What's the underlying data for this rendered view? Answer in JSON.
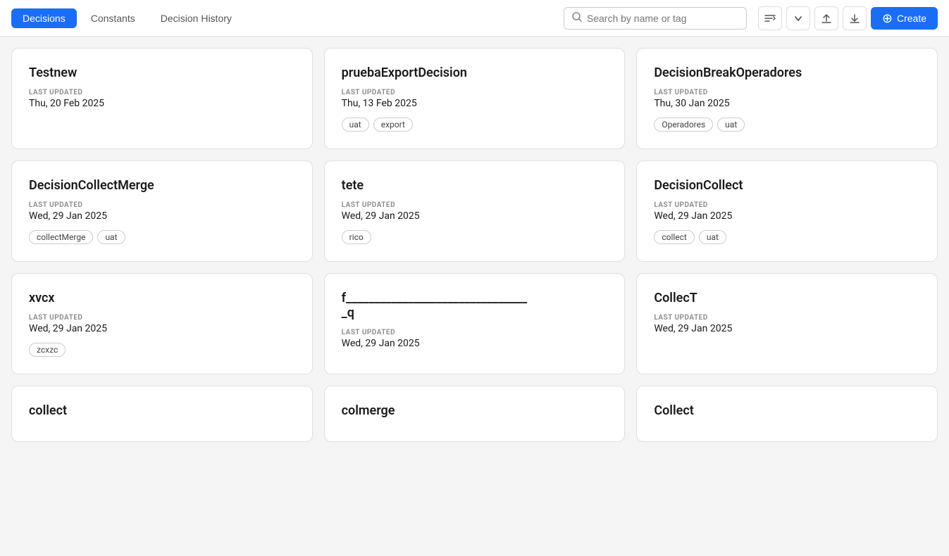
{
  "header": {
    "tabs": [
      {
        "label": "Decisions",
        "active": true
      },
      {
        "label": "Constants",
        "active": false
      },
      {
        "label": "Decision History",
        "active": false
      }
    ],
    "search": {
      "placeholder": "Search by name or tag"
    },
    "create_label": "Create"
  },
  "cards": [
    {
      "title": "Testnew",
      "last_updated_label": "LAST UPDATED",
      "last_updated": "Thu, 20 Feb 2025",
      "tags": []
    },
    {
      "title": "pruebaExportDecision",
      "last_updated_label": "LAST UPDATED",
      "last_updated": "Thu, 13 Feb 2025",
      "tags": [
        "uat",
        "export"
      ]
    },
    {
      "title": "DecisionBreakOperadores",
      "last_updated_label": "LAST UPDATED",
      "last_updated": "Thu, 30 Jan 2025",
      "tags": [
        "Operadores",
        "uat"
      ]
    },
    {
      "title": "DecisionCollectMerge",
      "last_updated_label": "LAST UPDATED",
      "last_updated": "Wed, 29 Jan 2025",
      "tags": [
        "collectMerge",
        "uat"
      ]
    },
    {
      "title": "tete",
      "last_updated_label": "LAST UPDATED",
      "last_updated": "Wed, 29 Jan 2025",
      "tags": [
        "rico"
      ]
    },
    {
      "title": "DecisionCollect",
      "last_updated_label": "LAST UPDATED",
      "last_updated": "Wed, 29 Jan 2025",
      "tags": [
        "collect",
        "uat"
      ]
    },
    {
      "title": "xvcx",
      "last_updated_label": "LAST UPDATED",
      "last_updated": "Wed, 29 Jan 2025",
      "tags": [
        "zcxzc"
      ]
    },
    {
      "title": "f________________________________\n_q",
      "last_updated_label": "LAST UPDATED",
      "last_updated": "Wed, 29 Jan 2025",
      "tags": []
    },
    {
      "title": "CollecT",
      "last_updated_label": "LAST UPDATED",
      "last_updated": "Wed, 29 Jan 2025",
      "tags": []
    },
    {
      "title": "collect",
      "last_updated_label": "",
      "last_updated": "",
      "tags": []
    },
    {
      "title": "colmerge",
      "last_updated_label": "",
      "last_updated": "",
      "tags": []
    },
    {
      "title": "Collect",
      "last_updated_label": "",
      "last_updated": "",
      "tags": []
    }
  ]
}
